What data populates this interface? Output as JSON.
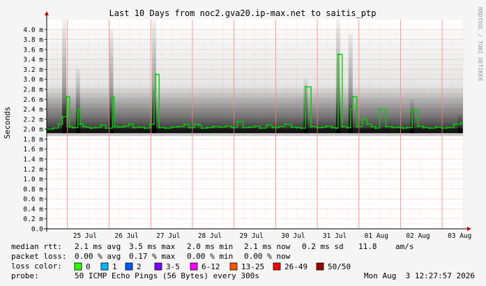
{
  "chart_data": {
    "type": "line",
    "title": "Last 10 Days from noc2.gva20.ip-max.net to saitis_ptp",
    "ylabel": "Seconds",
    "ylim": [
      0,
      4.2
    ],
    "yticks": [
      {
        "v": 0,
        "label": "0.0"
      },
      {
        "v": 0.2,
        "label": "0.2 m"
      },
      {
        "v": 0.4,
        "label": "0.4 m"
      },
      {
        "v": 0.6,
        "label": "0.6 m"
      },
      {
        "v": 0.8,
        "label": "0.8 m"
      },
      {
        "v": 1.0,
        "label": "1.0 m"
      },
      {
        "v": 1.2,
        "label": "1.2 m"
      },
      {
        "v": 1.4,
        "label": "1.4 m"
      },
      {
        "v": 1.6,
        "label": "1.6 m"
      },
      {
        "v": 1.8,
        "label": "1.8 m"
      },
      {
        "v": 2.0,
        "label": "2.0 m"
      },
      {
        "v": 2.2,
        "label": "2.2 m"
      },
      {
        "v": 2.4,
        "label": "2.4 m"
      },
      {
        "v": 2.6,
        "label": "2.6 m"
      },
      {
        "v": 2.8,
        "label": "2.8 m"
      },
      {
        "v": 3.0,
        "label": "3.0 m"
      },
      {
        "v": 3.2,
        "label": "3.2 m"
      },
      {
        "v": 3.4,
        "label": "3.4 m"
      },
      {
        "v": 3.6,
        "label": "3.6 m"
      },
      {
        "v": 3.8,
        "label": "3.8 m"
      },
      {
        "v": 4.0,
        "label": "4.0 m"
      }
    ],
    "xlim": [
      0,
      10
    ],
    "xticks": [
      {
        "v": 0.92,
        "label": "25 Jul"
      },
      {
        "v": 1.92,
        "label": "26 Jul"
      },
      {
        "v": 2.92,
        "label": "27 Jul"
      },
      {
        "v": 3.92,
        "label": "28 Jul"
      },
      {
        "v": 4.92,
        "label": "29 Jul"
      },
      {
        "v": 5.92,
        "label": "30 Jul"
      },
      {
        "v": 6.92,
        "label": "31 Jul"
      },
      {
        "v": 7.92,
        "label": "01 Aug"
      },
      {
        "v": 8.92,
        "label": "02 Aug"
      },
      {
        "v": 9.92,
        "label": "03 Aug"
      }
    ],
    "midnights": [
      0.5,
      1.5,
      2.5,
      3.5,
      4.5,
      5.5,
      6.5,
      7.5,
      8.5,
      9.5
    ],
    "series": [
      {
        "name": "median rtt",
        "color": "#00cc00",
        "x": [
          0.0,
          0.15,
          0.28,
          0.38,
          0.48,
          0.55,
          0.62,
          0.75,
          0.8,
          0.88,
          0.95,
          1.05,
          1.15,
          1.3,
          1.42,
          1.58,
          1.62,
          1.72,
          1.85,
          1.98,
          2.08,
          2.22,
          2.35,
          2.48,
          2.58,
          2.62,
          2.7,
          2.85,
          3.0,
          3.15,
          3.3,
          3.42,
          3.55,
          3.65,
          3.72,
          3.85,
          4.0,
          4.15,
          4.3,
          4.45,
          4.58,
          4.72,
          4.88,
          5.0,
          5.12,
          5.28,
          5.42,
          5.58,
          5.72,
          5.88,
          6.0,
          6.12,
          6.22,
          6.35,
          6.5,
          6.62,
          6.72,
          6.85,
          6.95,
          7.0,
          7.1,
          7.22,
          7.3,
          7.35,
          7.45,
          7.58,
          7.7,
          7.8,
          7.9,
          8.0,
          8.15,
          8.3,
          8.45,
          8.55,
          8.65,
          8.78,
          8.92,
          9.05,
          9.2,
          9.35,
          9.5,
          9.62,
          9.78,
          9.95
        ],
        "y": [
          2.0,
          2.02,
          2.1,
          2.25,
          2.65,
          2.05,
          2.03,
          2.4,
          2.1,
          2.05,
          2.04,
          2.02,
          2.03,
          2.08,
          2.02,
          2.65,
          2.05,
          2.04,
          2.06,
          2.1,
          2.03,
          2.04,
          2.02,
          2.1,
          2.75,
          3.1,
          2.03,
          2.02,
          2.04,
          2.05,
          2.1,
          2.03,
          2.1,
          2.08,
          2.02,
          2.03,
          2.05,
          2.04,
          2.06,
          2.03,
          2.15,
          2.03,
          2.04,
          2.06,
          2.02,
          2.08,
          2.03,
          2.05,
          2.1,
          2.04,
          2.03,
          2.02,
          2.85,
          2.05,
          2.03,
          2.04,
          2.06,
          2.03,
          2.02,
          3.5,
          2.05,
          2.03,
          2.4,
          2.65,
          2.05,
          2.2,
          2.1,
          2.05,
          2.02,
          2.4,
          2.05,
          2.03,
          2.04,
          2.02,
          2.03,
          2.38,
          2.06,
          2.03,
          2.02,
          2.04,
          2.02,
          2.03,
          2.1,
          2.12
        ]
      }
    ],
    "spikes": [
      {
        "x": 0.42,
        "h": 4.2
      },
      {
        "x": 0.75,
        "h": 3.2
      },
      {
        "x": 1.55,
        "h": 4.0
      },
      {
        "x": 2.58,
        "h": 4.2
      },
      {
        "x": 6.22,
        "h": 3.0
      },
      {
        "x": 7.0,
        "h": 4.2
      },
      {
        "x": 7.3,
        "h": 3.9
      },
      {
        "x": 8.78,
        "h": 2.6
      },
      {
        "x": 9.92,
        "h": 2.3
      }
    ],
    "footer": {
      "median": {
        "label": "median rtt:",
        "avg": "2.1 ms avg",
        "max": "3.5 ms max",
        "min": "2.0 ms min",
        "now": "2.1 ms now",
        "sd": "0.2 ms sd",
        "ams": "11.8    am/s"
      },
      "loss": {
        "label": "packet loss:",
        "avg": "0.00 % avg",
        "max": "0.17 % max",
        "min": "0.00 % min",
        "now": "0.00 % now"
      },
      "loss_color": {
        "label": "loss color:",
        "items": [
          {
            "label": "0",
            "color": "#26ff00"
          },
          {
            "label": "1",
            "color": "#00b8ff"
          },
          {
            "label": "2",
            "color": "#0059ff"
          },
          {
            "label": "3-5",
            "color": "#7e00ff"
          },
          {
            "label": "6-12",
            "color": "#ff00ff"
          },
          {
            "label": "13-25",
            "color": "#ff5500"
          },
          {
            "label": "26-49",
            "color": "#ff0000"
          },
          {
            "label": "50/50",
            "color": "#a10000"
          }
        ]
      },
      "probe": {
        "label": "probe:",
        "text": "50 ICMP Echo Pings (56 Bytes) every 300s",
        "timestamp": "Mon Aug  3 12:27:57 2026"
      }
    },
    "sidebar_text": "RRDTOOL / TOBI OETIKER"
  }
}
